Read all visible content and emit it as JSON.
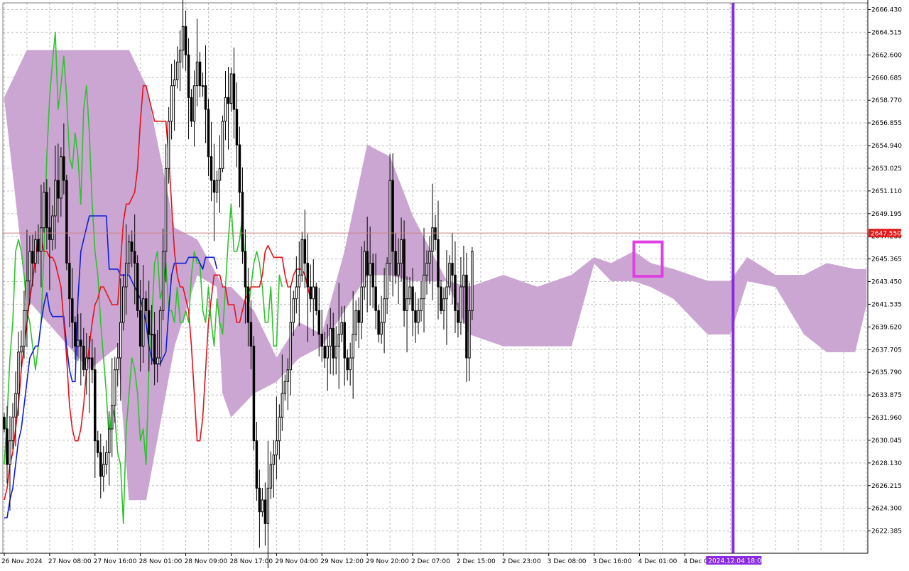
{
  "chart_data": {
    "type": "candlestick",
    "price_axis": {
      "ylim": [
        2620.5,
        2667.0
      ],
      "ticks": [
        "2666.430",
        "2664.515",
        "2662.600",
        "2660.685",
        "2658.770",
        "2656.855",
        "2654.940",
        "2653.025",
        "2651.110",
        "2649.195",
        "2647.280",
        "2645.365",
        "2643.450",
        "2641.535",
        "2639.620",
        "2637.705",
        "2635.790",
        "2633.875",
        "2631.960",
        "2630.045",
        "2628.130",
        "2626.215",
        "2624.300",
        "2622.385"
      ],
      "tick_values": [
        2666.43,
        2664.515,
        2662.6,
        2660.685,
        2658.77,
        2656.855,
        2654.94,
        2653.025,
        2651.11,
        2649.195,
        2647.28,
        2645.365,
        2643.45,
        2641.535,
        2639.62,
        2637.705,
        2635.79,
        2633.875,
        2631.96,
        2630.045,
        2628.13,
        2626.215,
        2624.3,
        2622.385
      ]
    },
    "time_axis": {
      "labels": [
        "26 Nov 2024",
        "27 Nov 08:00",
        "27 Nov 16:00",
        "28 Nov 01:00",
        "28 Nov 09:00",
        "28 Nov 17:00",
        "29 Nov 04:00",
        "29 Nov 12:00",
        "29 Nov 20:00",
        "2 Dec 07:00",
        "2 Dec 15:00",
        "2 Dec 23:00",
        "3 Dec 08:00",
        "3 Dec 16:00",
        "4 Dec 01:00",
        "4 Dec 0"
      ],
      "label_bars": [
        0,
        16,
        32,
        48,
        64,
        80,
        96,
        112,
        128,
        144,
        160,
        176,
        192,
        208,
        224,
        240
      ],
      "total_slots": 305
    },
    "current_price": {
      "value": 2647.55,
      "label": "2647.550"
    },
    "time_marker": {
      "bar": 257,
      "label": "2024.12.04 18:00"
    },
    "highlight_box": {
      "bar_start": 222,
      "bar_end": 232,
      "price_top": 2646.8,
      "price_bottom": 2643.9
    },
    "colors": {
      "bull": "#000000",
      "bear": "#000000",
      "tenkan": "#e8101a",
      "kijun": "#0c1ed8",
      "chikou": "#2cc42c",
      "cloud_bull": "#cba6d2",
      "cloud_bear": "#f0a45c",
      "price_line": "#c98080",
      "price_badge": "#e21a1a",
      "time_marker": "#8a2be2",
      "highlight": "#e040e0",
      "grid": "#bfbfbf"
    },
    "closes": [
      2631,
      2628,
      2630,
      2632,
      2634,
      2637.5,
      2638,
      2641,
      2643.5,
      2646,
      2645,
      2647,
      2646,
      2648,
      2651,
      2648,
      2647,
      2649,
      2652,
      2650.5,
      2654,
      2652,
      2645,
      2642,
      2640,
      2638,
      2638.5,
      2638,
      2636,
      2637,
      2637,
      2636,
      2630,
      2629,
      2627,
      2628,
      2629,
      2631,
      2633,
      2636,
      2637,
      2640,
      2643,
      2645,
      2646.8,
      2646,
      2645,
      2641,
      2638,
      2642,
      2641,
      2639,
      2639,
      2636.5,
      2637,
      2641,
      2646,
      2653,
      2657,
      2660,
      2660.5,
      2662,
      2663,
      2665,
      2662.6,
      2659,
      2657,
      2660,
      2662,
      2660,
      2660,
      2658,
      2654,
      2652,
      2651,
      2652,
      2653,
      2657,
      2659,
      2658.5,
      2661,
      2658,
      2655,
      2651,
      2646,
      2643,
      2640,
      2638,
      2630,
      2626,
      2624,
      2625,
      2623,
      2626,
      2628,
      2628.8,
      2630,
      2632,
      2634,
      2635,
      2636,
      2640,
      2642,
      2643,
      2644,
      2647,
      2645,
      2643,
      2642,
      2643,
      2641,
      2639,
      2638,
      2637,
      2638,
      2639.5,
      2637,
      2638,
      2639,
      2640,
      2637,
      2636,
      2637,
      2639,
      2641,
      2640,
      2643,
      2646,
      2644,
      2645,
      2643,
      2641,
      2639,
      2640,
      2642,
      2645,
      2652,
      2646,
      2644,
      2645,
      2647,
      2641,
      2642,
      2643,
      2641,
      2640,
      2641,
      2642,
      2644,
      2645,
      2646,
      2648,
      2647,
      2643,
      2641,
      2642,
      2643,
      2645,
      2644,
      2641,
      2640,
      2643,
      2644,
      2637,
      2641,
      2646
    ],
    "tenkan": [
      2625,
      2626,
      2628,
      2629,
      2631,
      2633,
      2636,
      2638,
      2640,
      2642,
      2643.5,
      2645.5,
      2647,
      2647,
      2646,
      2646,
      2645.5,
      2645.5,
      2645,
      2644,
      2643,
      2640,
      2637,
      2633,
      2631,
      2630,
      2630,
      2631,
      2633,
      2636,
      2638,
      2640,
      2641.5,
      2642,
      2643,
      2643,
      2642.5,
      2642,
      2641.5,
      2641.5,
      2641.5,
      2645,
      2648.5,
      2650,
      2650,
      2650.5,
      2651,
      2653,
      2657,
      2660,
      2660,
      2659,
      2658,
      2657,
      2657,
      2657,
      2657,
      2657,
      2654,
      2650,
      2646,
      2644,
      2643,
      2643,
      2642,
      2641,
      2638,
      2634,
      2630,
      2630,
      2632,
      2636,
      2640,
      2642,
      2644,
      2644,
      2644,
      2643,
      2643,
      2641.5,
      2641.5,
      2641.5,
      2640,
      2640,
      2641,
      2642,
      2642.5,
      2643,
      2643,
      2643,
      2643,
      2644,
      2646,
      2646.5,
      2646,
      2645.5,
      2645.5,
      2645.5,
      2645.5,
      2644,
      2643,
      2643,
      2644,
      2644.5,
      2644.5,
      2644.5,
      2644,
      2643,
      2642
    ],
    "kijun": [
      2623.5,
      2623.5,
      2625,
      2626,
      2628,
      2630,
      2631,
      2633,
      2635,
      2637,
      2637.5,
      2638,
      2638,
      2640,
      2641.5,
      2642.5,
      2641,
      2640.5,
      2640.5,
      2640.5,
      2640.5,
      2640.5,
      2638,
      2636,
      2635,
      2635,
      2642,
      2646,
      2647,
      2648,
      2649,
      2649,
      2649,
      2649,
      2649,
      2649,
      2649,
      2644.5,
      2644.5,
      2644.5,
      2644.5,
      2644,
      2644,
      2644,
      2644,
      2643.5,
      2643,
      2642.5,
      2642,
      2641,
      2640,
      2638,
      2637,
      2636.5,
      2636.5,
      2636.5,
      2637,
      2637.5,
      2641,
      2644,
      2645,
      2645,
      2645,
      2645,
      2645,
      2645.5,
      2645.5,
      2645.5,
      2645.5,
      2645,
      2644.5,
      2645.5,
      2645.5,
      2645.5,
      2645.5,
      2644.5
    ],
    "chikou": [
      2628,
      2632,
      2637,
      2640,
      2646,
      2647,
      2646,
      2644,
      2641,
      2640,
      2638,
      2636,
      2638,
      2640,
      2646,
      2654,
      2659,
      2662,
      2664.5,
      2658,
      2660,
      2662.5,
      2659,
      2654,
      2653,
      2656,
      2654,
      2650,
      2658,
      2660,
      2656,
      2650,
      2646,
      2644,
      2640,
      2637,
      2634,
      2630,
      2633,
      2632,
      2629,
      2628,
      2623,
      2631,
      2634,
      2637,
      2636,
      2634,
      2630,
      2631,
      2628,
      2636,
      2640,
      2645,
      2646,
      2642,
      2643,
      2645,
      2641,
      2641,
      2640,
      2643,
      2640,
      2640,
      2641,
      2640,
      2644,
      2646,
      2645,
      2645,
      2641,
      2640,
      2643,
      2640,
      2638,
      2642,
      2640,
      2639,
      2643,
      2647,
      2650,
      2646,
      2646,
      2647,
      2649,
      2644,
      2641,
      2643,
      2645,
      2646,
      2645,
      2643,
      2640,
      2640,
      2643,
      2638,
      2638,
      2644,
      2643
    ],
    "cloud": [
      {
        "bar": 0,
        "a": 2659,
        "b": 2659
      },
      {
        "bar": 8,
        "a": 2663,
        "b": 2642
      },
      {
        "bar": 30,
        "a": 2663,
        "b": 2636
      },
      {
        "bar": 40,
        "a": 2663,
        "b": 2638
      },
      {
        "bar": 44,
        "a": 2663,
        "b": 2625
      },
      {
        "bar": 50,
        "a": 2660,
        "b": 2625
      },
      {
        "bar": 60,
        "a": 2648,
        "b": 2638
      },
      {
        "bar": 68,
        "a": 2647,
        "b": 2644
      },
      {
        "bar": 75,
        "a": 2644,
        "b": 2643
      },
      {
        "bar": 77,
        "a": 2643,
        "b": 2634
      },
      {
        "bar": 80,
        "a": 2643,
        "b": 2632
      },
      {
        "bar": 88,
        "a": 2641,
        "b": 2634
      },
      {
        "bar": 96,
        "a": 2637,
        "b": 2635
      },
      {
        "bar": 104,
        "a": 2640,
        "b": 2637
      },
      {
        "bar": 112,
        "a": 2639,
        "b": 2638
      },
      {
        "bar": 120,
        "a": 2646,
        "b": 2641
      },
      {
        "bar": 128,
        "a": 2655,
        "b": 2644
      },
      {
        "bar": 136,
        "a": 2654,
        "b": 2644
      },
      {
        "bar": 144,
        "a": 2649,
        "b": 2643.5
      },
      {
        "bar": 156,
        "a": 2643.5,
        "b": 2643.5
      },
      {
        "bar": 164,
        "a": 2643,
        "b": 2639
      },
      {
        "bar": 176,
        "a": 2644,
        "b": 2638
      },
      {
        "bar": 188,
        "a": 2643,
        "b": 2638
      },
      {
        "bar": 200,
        "a": 2644,
        "b": 2638
      },
      {
        "bar": 208,
        "a": 2645.5,
        "b": 2645
      },
      {
        "bar": 214,
        "a": 2645,
        "b": 2643.5
      },
      {
        "bar": 222,
        "a": 2646,
        "b": 2643.5
      },
      {
        "bar": 228,
        "a": 2645,
        "b": 2643
      },
      {
        "bar": 236,
        "a": 2644.5,
        "b": 2642
      },
      {
        "bar": 248,
        "a": 2643.5,
        "b": 2639
      },
      {
        "bar": 256,
        "a": 2643.5,
        "b": 2639
      },
      {
        "bar": 262,
        "a": 2645.5,
        "b": 2643.5
      },
      {
        "bar": 272,
        "a": 2644,
        "b": 2643
      },
      {
        "bar": 282,
        "a": 2644,
        "b": 2639
      },
      {
        "bar": 290,
        "a": 2645,
        "b": 2637.5
      },
      {
        "bar": 300,
        "a": 2644.5,
        "b": 2637.5
      },
      {
        "bar": 304,
        "a": 2644.5,
        "b": 2641.5
      }
    ]
  }
}
